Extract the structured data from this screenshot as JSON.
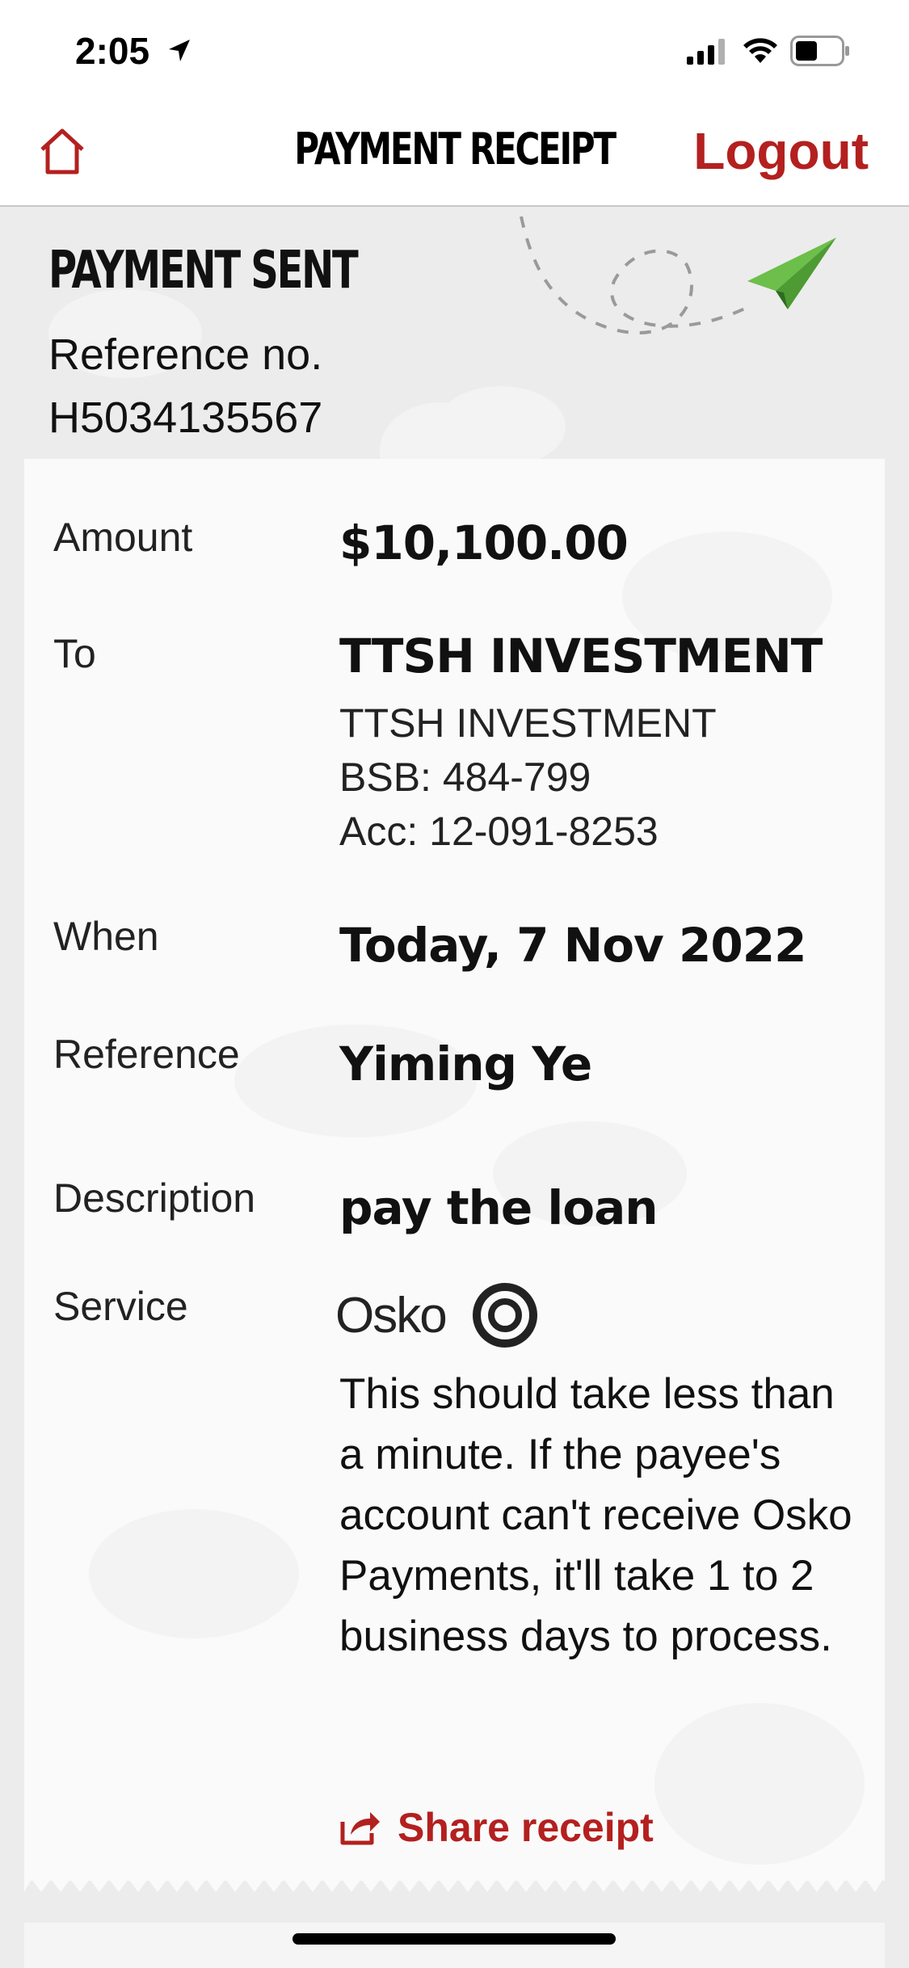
{
  "status_bar": {
    "time": "2:05"
  },
  "header": {
    "title": "PAYMENT RECEIPT",
    "logout_label": "Logout"
  },
  "hero": {
    "title": "PAYMENT SENT",
    "reference_label": "Reference no.",
    "reference_number": "H5034135567"
  },
  "receipt": {
    "amount": {
      "label": "Amount",
      "value": "$10,100.00"
    },
    "to": {
      "label": "To",
      "name": "TTSH INVESTMENT",
      "account_name": "TTSH INVESTMENT",
      "bsb": "BSB: 484-799",
      "account": "Acc: 12-091-8253"
    },
    "when": {
      "label": "When",
      "value": "Today, 7 Nov 2022"
    },
    "reference": {
      "label": "Reference",
      "value": "Yiming Ye"
    },
    "description": {
      "label": "Description",
      "value": "pay the loan"
    },
    "service": {
      "label": "Service",
      "logo_text": "Osko",
      "text": "This should take less than a minute. If the payee's account can't receive Osko Payments, it'll take 1 to 2 business days to process."
    },
    "share_label": "Share receipt"
  },
  "colors": {
    "brand_red": "#b3201f",
    "plane_green": "#6cbf4a",
    "background": "#ececec"
  },
  "icons": {
    "home": "home-icon",
    "share": "share-icon",
    "plane": "paper-plane-icon",
    "osko": "osko-logo-icon"
  }
}
